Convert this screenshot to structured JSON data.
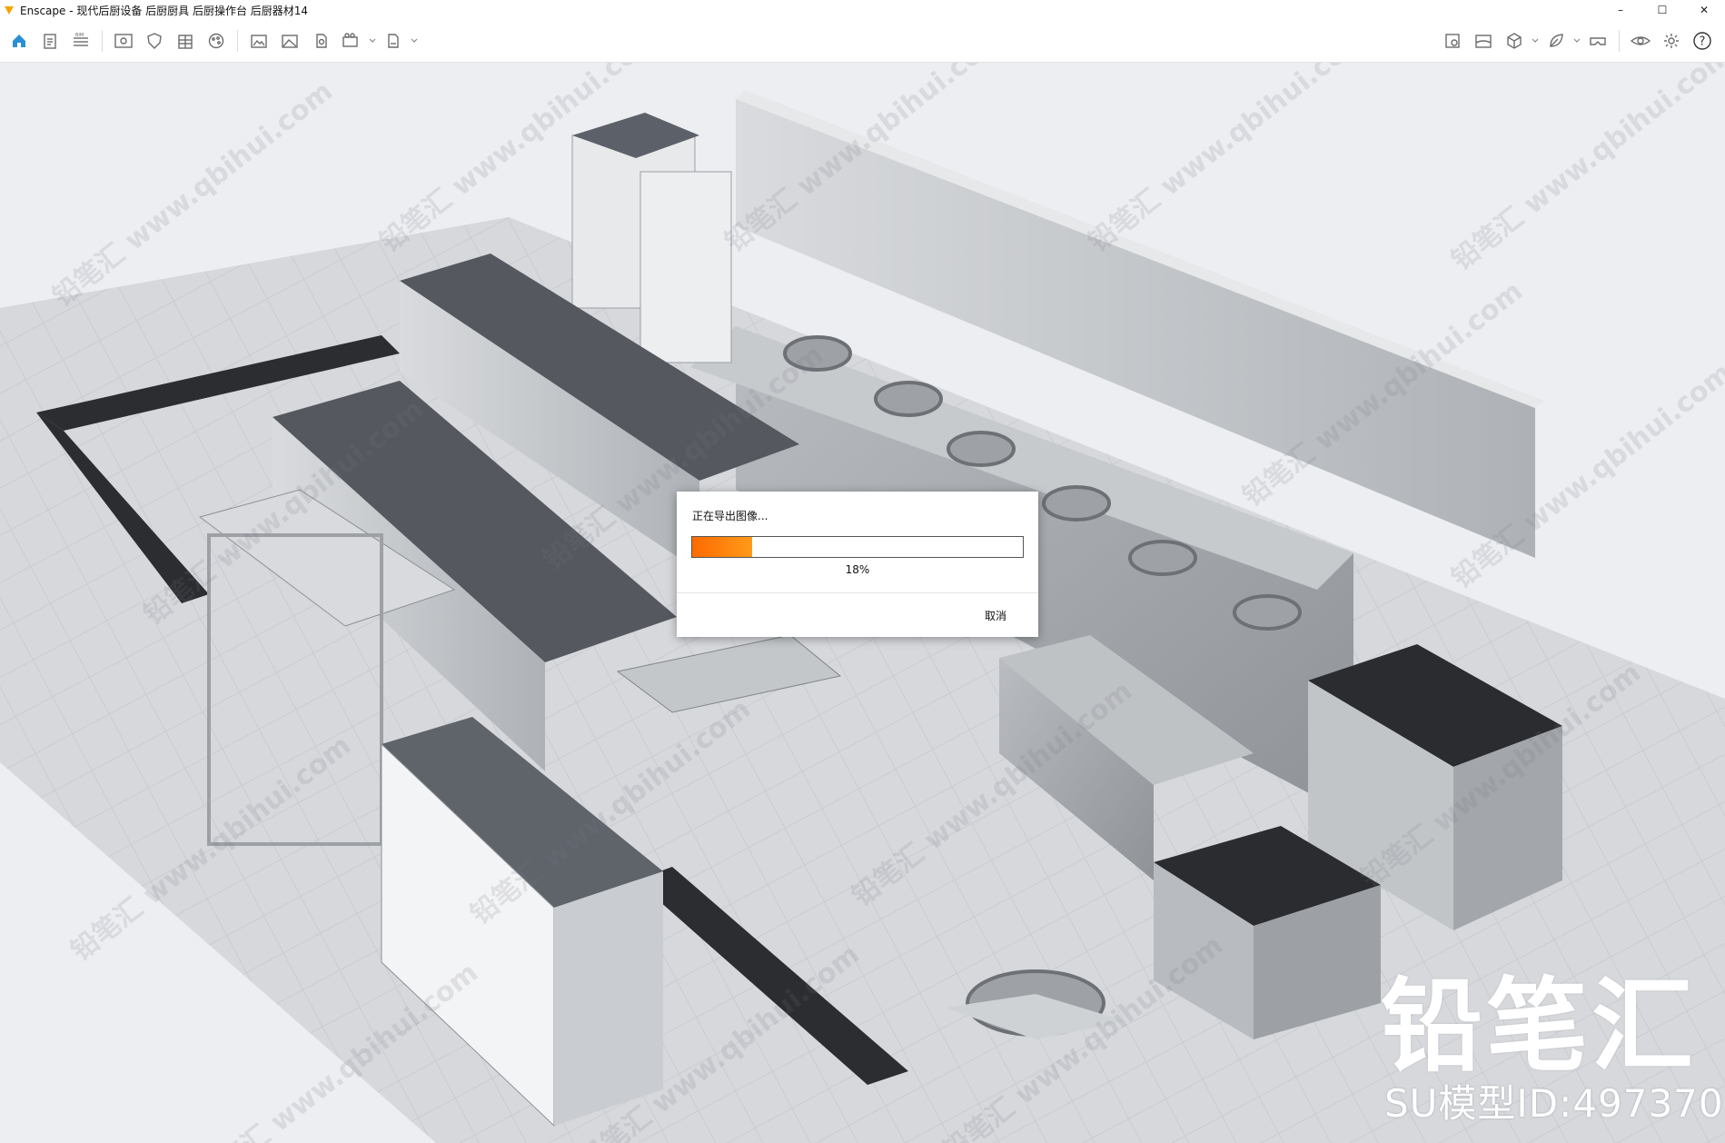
{
  "window": {
    "title": "Enscape - 现代后厨设备 后厨厨具 后厨操作台 后厨器材14",
    "controls": {
      "minimize": "–",
      "maximize": "☐",
      "close": "✕"
    }
  },
  "toolbar": {
    "left_icons": [
      "home-icon",
      "clipboard-icon",
      "bim-list-icon",
      "view-icon",
      "shield-icon",
      "building-icon",
      "palette-icon",
      "screenshot-icon",
      "image-icon",
      "panorama-icon",
      "video-icon",
      "export-icon"
    ],
    "right_icons": [
      "map-icon",
      "sky-icon",
      "cube-icon",
      "leaf-icon",
      "vr-icon",
      "eye-icon",
      "settings-icon",
      "help-icon"
    ],
    "help_label": "?",
    "accent_color": "#2b8fd6"
  },
  "viewport": {
    "watermarks": [
      "铅笔汇 www.qbihui.com"
    ],
    "brand": "铅笔汇",
    "model_id": "SU模型ID:497370"
  },
  "dialog": {
    "title": "正在导出图像...",
    "progress": 0.18,
    "progress_text": "18%",
    "cancel_label": "取消",
    "bar_color": "#ff7a00"
  }
}
